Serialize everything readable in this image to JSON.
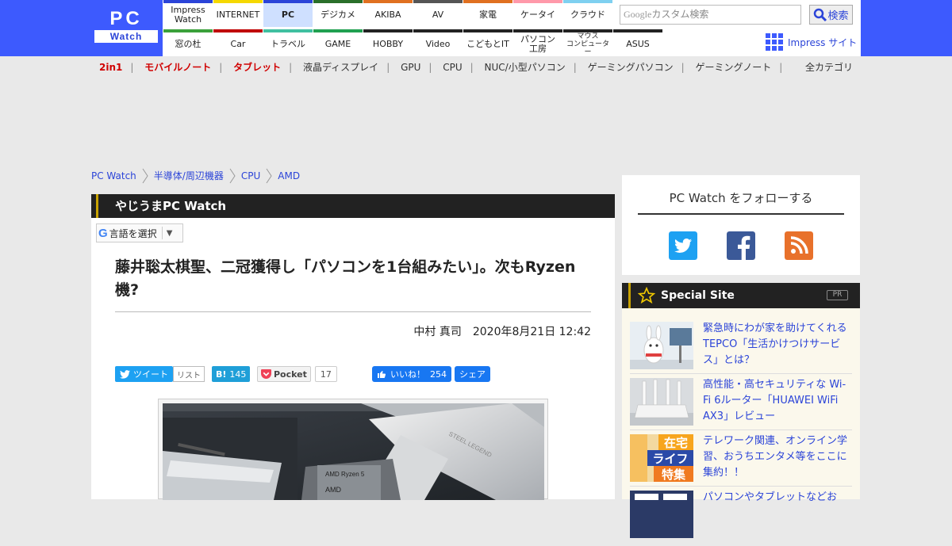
{
  "header": {
    "logo_top": "PC",
    "logo_bottom": "Watch",
    "nav_row1": [
      {
        "label": "Impress\nWatch",
        "color": "#2b44d8"
      },
      {
        "label": "INTERNET",
        "color": "#f5d800"
      },
      {
        "label": "PC",
        "color": "#2b44d8",
        "active": true
      },
      {
        "label": "デジカメ",
        "color": "#2a6f2a"
      },
      {
        "label": "AKIBA",
        "color": "#e07020"
      },
      {
        "label": "AV",
        "color": "#555555"
      },
      {
        "label": "家電",
        "color": "#e07020"
      },
      {
        "label": "ケータイ",
        "color": "#ff99aa"
      },
      {
        "label": "クラウド",
        "color": "#7fd0f0"
      }
    ],
    "nav_row2": [
      {
        "label": "窓の杜",
        "color": "#3aa03a"
      },
      {
        "label": "Car",
        "color": "#c00000"
      },
      {
        "label": "トラベル",
        "color": "#40c0a0"
      },
      {
        "label": "GAME",
        "color": "#20a050"
      },
      {
        "label": "HOBBY",
        "color": "#222222"
      },
      {
        "label": "Video",
        "color": "#222222"
      },
      {
        "label": "こどもとIT",
        "color": "#222222"
      },
      {
        "label": "パソコン\n工房",
        "color": "#222222"
      },
      {
        "label": "マウス\nコンピューター",
        "color": "#222222"
      },
      {
        "label": "ASUS",
        "color": "#222222"
      }
    ],
    "search_google": "Google",
    "search_placeholder": "カスタム検索",
    "search_button": "検索",
    "impress_site": "Impress サイト"
  },
  "subnav": {
    "items": [
      {
        "label": "2in1",
        "red": true
      },
      {
        "label": "モバイルノート",
        "red": true
      },
      {
        "label": "タブレット",
        "red": true
      },
      {
        "label": "液晶ディスプレイ"
      },
      {
        "label": "GPU"
      },
      {
        "label": "CPU"
      },
      {
        "label": "NUC/小型パソコン"
      },
      {
        "label": "ゲーミングパソコン"
      },
      {
        "label": "ゲーミングノート"
      }
    ],
    "all_categories": "全カテゴリ"
  },
  "breadcrumb": [
    "PC Watch",
    "半導体/周辺機器",
    "CPU",
    "AMD"
  ],
  "article": {
    "section": "やじうまPC Watch",
    "translate_label": "言語を選択",
    "translate_arrow": "▼",
    "title": "藤井聡太棋聖、二冠獲得し「パソコンを1台組みたい」。次もRyzen機?",
    "author": "中村 真司",
    "date": "2020年8月21日 12:42",
    "share": {
      "tweet": "ツイート",
      "list": "リスト",
      "hatena_count": "145",
      "hatena_icon": "B!",
      "pocket": "Pocket",
      "pocket_count": "17",
      "like": "いいね！",
      "like_count": "254",
      "share": "シェア"
    }
  },
  "sidebar": {
    "follow_title": "PC Watch をフォローする",
    "special_title": "Special Site",
    "pr": "PR",
    "items": [
      {
        "text": "緊急時にわが家を助けてくれるTEPCO「生活かけつけサービス」とは？"
      },
      {
        "text": "高性能・高セキュリティな Wi-Fi 6ルーター「HUAWEI WiFi AX3」レビュー"
      },
      {
        "text": "テレワーク関連、オンライン学習、おうちエンタメ等をここに集約！！",
        "thumb_lines": [
          "在宅",
          "ライフ",
          "特集"
        ]
      },
      {
        "text": "パソコンやタブレットなどお"
      }
    ]
  }
}
